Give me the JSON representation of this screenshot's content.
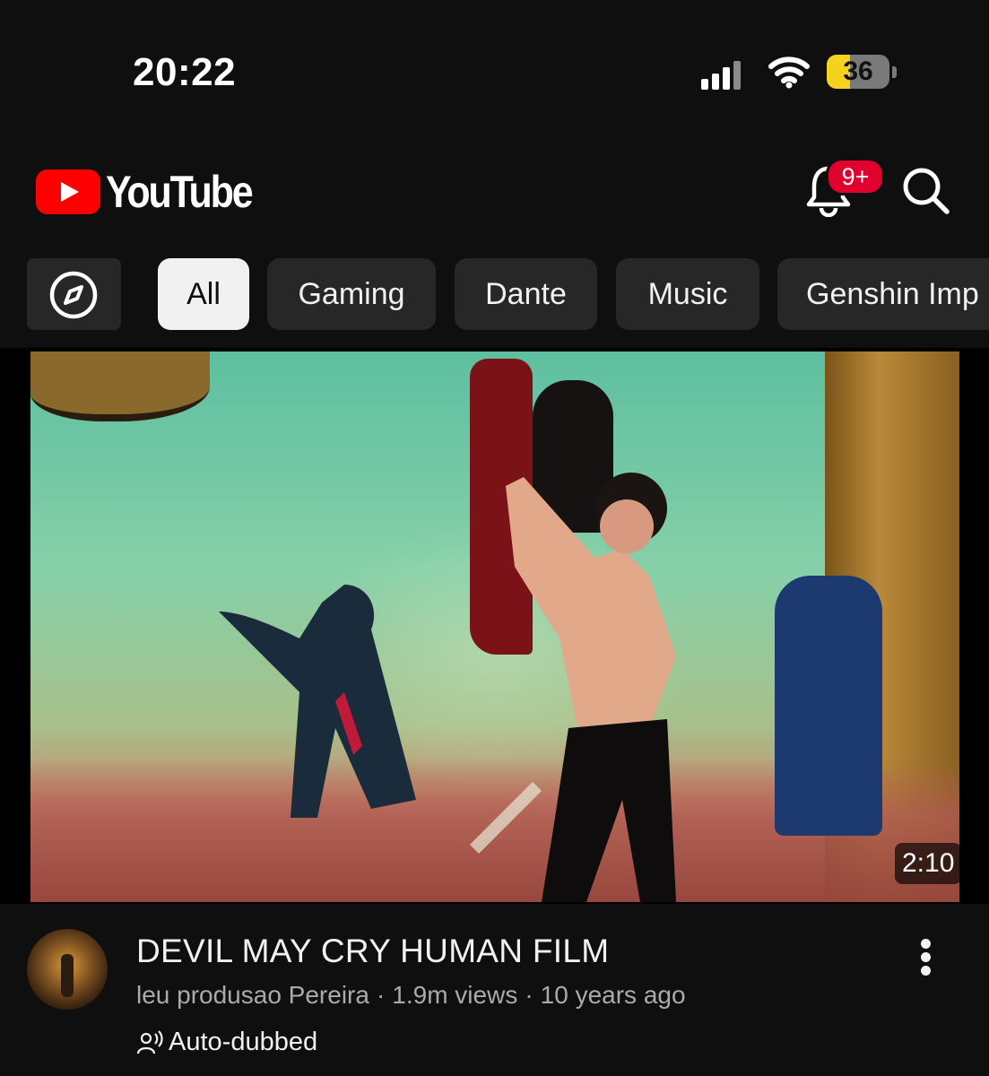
{
  "status_bar": {
    "time": "20:22",
    "battery_percent": "36",
    "battery_color": "#f4d21d",
    "icons": [
      "signal-icon",
      "wifi-icon",
      "battery-icon"
    ]
  },
  "header": {
    "logo_text": "YouTube",
    "notification_badge": "9+",
    "accent_color": "#ff0000",
    "icons": [
      "bell-icon",
      "search-icon"
    ]
  },
  "chips": {
    "explore_icon": "compass-icon",
    "items": [
      {
        "label": "All",
        "active": true
      },
      {
        "label": "Gaming",
        "active": false
      },
      {
        "label": "Dante",
        "active": false
      },
      {
        "label": "Music",
        "active": false
      },
      {
        "label": "Genshin Imp",
        "active": false
      }
    ]
  },
  "video": {
    "duration": "2:10",
    "title": "DEVIL MAY CRY HUMAN FILM",
    "channel": "leu produsao Pereira",
    "views": "1.9m views",
    "age": "10 years ago",
    "separator": "·",
    "auto_dubbed": "Auto-dubbed"
  }
}
